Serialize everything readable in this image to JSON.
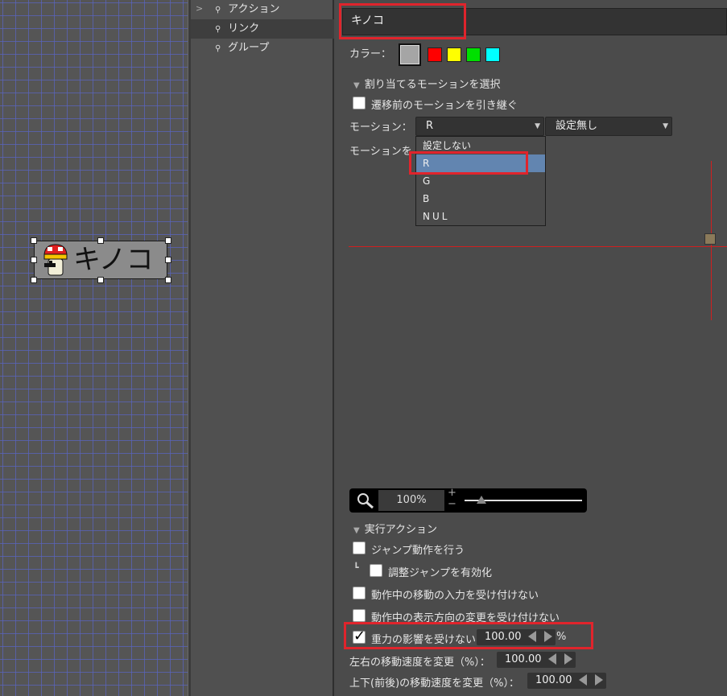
{
  "canvas": {
    "node": {
      "label": "キノコ"
    }
  },
  "tree": {
    "items": [
      {
        "label": "アクション"
      },
      {
        "label": "リンク"
      },
      {
        "label": "グループ"
      }
    ]
  },
  "props": {
    "name": "キノコ",
    "color_label": "カラー：",
    "colors": [
      "#a5a5a5",
      "#ff0000",
      "#ffff00",
      "#00e000",
      "#00ffff"
    ],
    "motion_section": {
      "header": "割り当てるモーションを選択",
      "inherit_label": "遷移前のモーションを引き継ぐ",
      "motion_label": "モーション：",
      "motion_value": "R",
      "second_value": "設定無し",
      "preview_label": "モーションを",
      "options": [
        "設定しない",
        "R",
        "G",
        "B",
        "NUL"
      ],
      "selected_option": "R"
    },
    "zoom": {
      "value": "100%",
      "plus": "+",
      "minus": "−"
    },
    "action_section": {
      "header": "実行アクション",
      "jump": "ジャンプ動作を行う",
      "adjust_jump_prefix": "┗",
      "adjust_jump": "調整ジャンプを有効化",
      "ignore_move": "動作中の移動の入力を受け付けない",
      "ignore_dir": "動作中の表示方向の変更を受け付けない",
      "gravity": "重力の影響を受けない",
      "gravity_value": "100.00",
      "gravity_unit": "%",
      "gravity_checked": true,
      "lr_speed_label": "左右の移動速度を変更（%）：",
      "lr_speed_value": "100.00",
      "ud_speed_label": "上下(前後)の移動速度を変更（%）：",
      "ud_speed_value": "100.00"
    }
  }
}
